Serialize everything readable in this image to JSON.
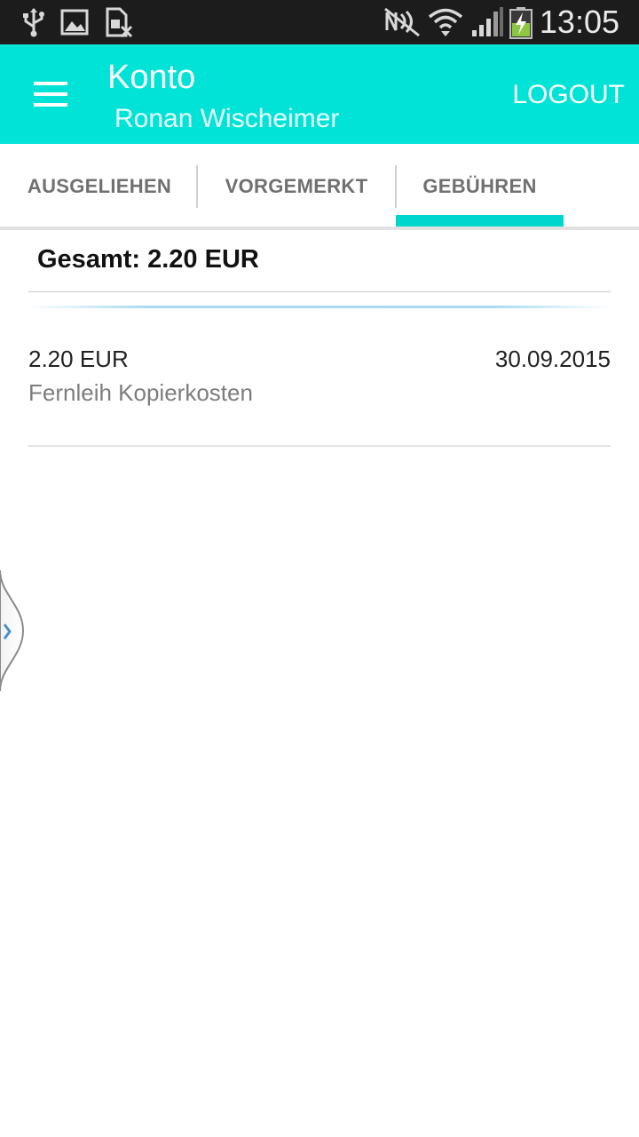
{
  "status_bar": {
    "time": "13:05",
    "icons": [
      "usb-icon",
      "image-icon",
      "sim-missing-icon",
      "nfc-off-icon",
      "wifi-icon",
      "signal-icon",
      "battery-charging-icon"
    ]
  },
  "app_bar": {
    "title": "Konto",
    "subtitle": "Ronan Wischeimer",
    "logout_label": "LOGOUT",
    "menu_icon": "hamburger-menu-icon",
    "accent_color": "#00e3d6"
  },
  "tabs": [
    {
      "label": "AUSGELIEHEN",
      "selected": false
    },
    {
      "label": "VORGEMERKT",
      "selected": false
    },
    {
      "label": "GEBÜHREN",
      "selected": true
    }
  ],
  "fees": {
    "total_label": "Gesamt: 2.20 EUR",
    "items": [
      {
        "amount": "2.20 EUR",
        "date": "30.09.2015",
        "description": "Fernleih Kopierkosten"
      }
    ]
  },
  "drawer_handle": {
    "icon": "chevron-right-icon"
  }
}
